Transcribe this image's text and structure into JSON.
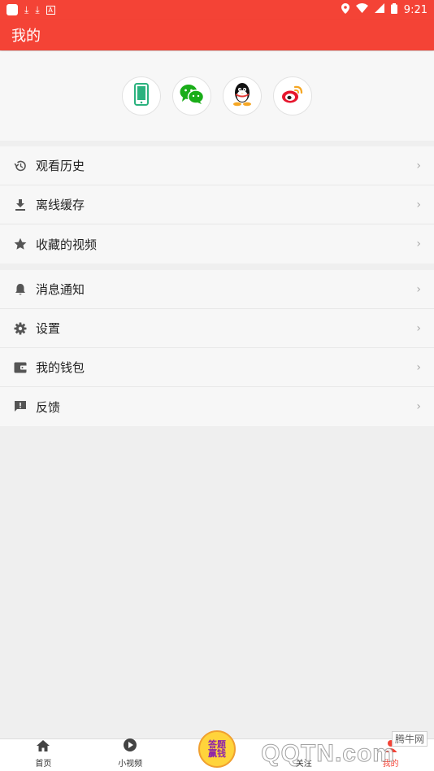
{
  "status_bar": {
    "time": "9:21"
  },
  "app_bar": {
    "title": "我的"
  },
  "login_options": [
    {
      "icon": "phone-icon"
    },
    {
      "icon": "wechat-icon"
    },
    {
      "icon": "qq-icon"
    },
    {
      "icon": "weibo-icon"
    }
  ],
  "menu_group1": [
    {
      "label": "观看历史",
      "icon": "history-icon"
    },
    {
      "label": "离线缓存",
      "icon": "download-icon"
    },
    {
      "label": "收藏的视频",
      "icon": "star-icon"
    }
  ],
  "menu_group2": [
    {
      "label": "消息通知",
      "icon": "bell-icon"
    },
    {
      "label": "设置",
      "icon": "gear-icon"
    },
    {
      "label": "我的钱包",
      "icon": "wallet-icon"
    },
    {
      "label": "反馈",
      "icon": "feedback-icon"
    }
  ],
  "chevron": "›",
  "tabs": [
    {
      "label": "首页",
      "icon": "home-icon"
    },
    {
      "label": "小视频",
      "icon": "play-icon"
    },
    {
      "label": "",
      "icon": "promo-icon"
    },
    {
      "label": "关注",
      "icon": "follow-icon"
    },
    {
      "label": "我的",
      "icon": "profile-icon"
    }
  ],
  "promo": {
    "text": "答题赢钱"
  },
  "watermark": {
    "main": "QQTN.com",
    "small": "腾牛网"
  },
  "colors": {
    "accent": "#f44336",
    "wechat": "#1aad19",
    "phone": "#2bb27e",
    "weibo": "#e6162d"
  }
}
